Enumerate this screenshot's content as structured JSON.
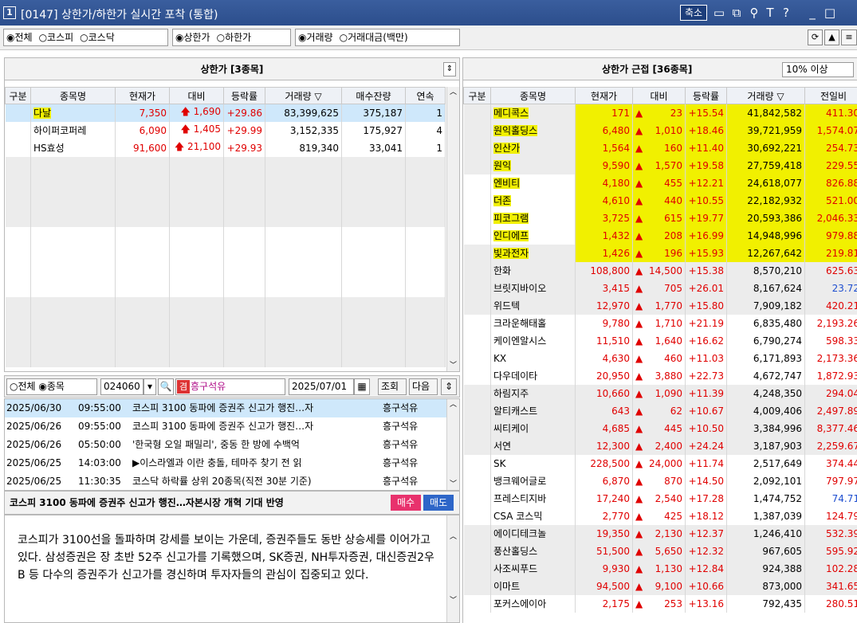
{
  "window": {
    "num": "1",
    "title": "[0147] 상한가/하한가 실시간 포착 (통합)",
    "shrink": "축소"
  },
  "toolbar": {
    "market": [
      "◉전체",
      "○코스피",
      "○코스닥"
    ],
    "limit": [
      "◉상한가",
      "○하한가"
    ],
    "basis": [
      "◉거래량",
      "○거래대금(백만)"
    ]
  },
  "left": {
    "title": "상한가 [3종목]",
    "headers": [
      "구분",
      "종목명",
      "현재가",
      "대비",
      "등락률",
      "거래량 ▽",
      "매수잔량",
      "연속"
    ],
    "rows": [
      {
        "name": "다날",
        "price": "7,350",
        "change": "1,690",
        "rate": "+29.86",
        "volume": "83,399,625",
        "bid": "375,187",
        "cont": "1"
      },
      {
        "name": "하이퍼코퍼레",
        "price": "6,090",
        "change": "1,405",
        "rate": "+29.99",
        "volume": "3,152,335",
        "bid": "175,927",
        "cont": "4"
      },
      {
        "name": "HS효성",
        "price": "91,600",
        "change": "21,100",
        "rate": "+29.93",
        "volume": "819,340",
        "bid": "33,041",
        "cont": "1"
      }
    ]
  },
  "right": {
    "title": "상한가 근접 [36종목]",
    "filter": "10% 이상",
    "headers": [
      "구분",
      "종목명",
      "현재가",
      "대비",
      "등락률",
      "거래량 ▽",
      "전일비"
    ],
    "rows": [
      {
        "name": "메디콕스",
        "price": "171",
        "change": "23",
        "rate": "+15.54",
        "volume": "41,842,582",
        "prev": "411.30",
        "hl": true
      },
      {
        "name": "원익홀딩스",
        "price": "6,480",
        "change": "1,010",
        "rate": "+18.46",
        "volume": "39,721,959",
        "prev": "1,574.07",
        "hl": true
      },
      {
        "name": "인산가",
        "price": "1,564",
        "change": "160",
        "rate": "+11.40",
        "volume": "30,692,221",
        "prev": "254.73",
        "hl": true
      },
      {
        "name": "원익",
        "price": "9,590",
        "change": "1,570",
        "rate": "+19.58",
        "volume": "27,759,418",
        "prev": "229.55",
        "hl": true
      },
      {
        "name": "엔비티",
        "price": "4,180",
        "change": "455",
        "rate": "+12.21",
        "volume": "24,618,077",
        "prev": "826.88",
        "hl": true
      },
      {
        "name": "더존",
        "price": "4,610",
        "change": "440",
        "rate": "+10.55",
        "volume": "22,182,932",
        "prev": "521.00",
        "hl": true
      },
      {
        "name": "피코그램",
        "price": "3,725",
        "change": "615",
        "rate": "+19.77",
        "volume": "20,593,386",
        "prev": "2,046.33",
        "hl": true
      },
      {
        "name": "인디에프",
        "price": "1,432",
        "change": "208",
        "rate": "+16.99",
        "volume": "14,948,996",
        "prev": "979.88",
        "hl": true
      },
      {
        "name": "빛과전자",
        "price": "1,426",
        "change": "196",
        "rate": "+15.93",
        "volume": "12,267,642",
        "prev": "219.81",
        "hl": true
      },
      {
        "name": "한화",
        "price": "108,800",
        "change": "14,500",
        "rate": "+15.38",
        "volume": "8,570,210",
        "prev": "625.63",
        "hl": false
      },
      {
        "name": "브릿지바이오",
        "price": "3,415",
        "change": "705",
        "rate": "+26.01",
        "volume": "8,167,624",
        "prev": "23.72",
        "hl": false,
        "prevBlue": true
      },
      {
        "name": "위드텍",
        "price": "12,970",
        "change": "1,770",
        "rate": "+15.80",
        "volume": "7,909,182",
        "prev": "420.21",
        "hl": false
      },
      {
        "name": "크라운해태홀",
        "price": "9,780",
        "change": "1,710",
        "rate": "+21.19",
        "volume": "6,835,480",
        "prev": "2,193.26",
        "hl": false
      },
      {
        "name": "케이엔알시스",
        "price": "11,510",
        "change": "1,640",
        "rate": "+16.62",
        "volume": "6,790,274",
        "prev": "598.33",
        "hl": false
      },
      {
        "name": "KX",
        "price": "4,630",
        "change": "460",
        "rate": "+11.03",
        "volume": "6,171,893",
        "prev": "2,173.36",
        "hl": false
      },
      {
        "name": "다우데이타",
        "price": "20,950",
        "change": "3,880",
        "rate": "+22.73",
        "volume": "4,672,747",
        "prev": "1,872.93",
        "hl": false
      },
      {
        "name": "하림지주",
        "price": "10,660",
        "change": "1,090",
        "rate": "+11.39",
        "volume": "4,248,350",
        "prev": "294.04",
        "hl": false
      },
      {
        "name": "알티캐스트",
        "price": "643",
        "change": "62",
        "rate": "+10.67",
        "volume": "4,009,406",
        "prev": "2,497.89",
        "hl": false
      },
      {
        "name": "씨티케이",
        "price": "4,685",
        "change": "445",
        "rate": "+10.50",
        "volume": "3,384,996",
        "prev": "8,377.46",
        "hl": false
      },
      {
        "name": "서연",
        "price": "12,300",
        "change": "2,400",
        "rate": "+24.24",
        "volume": "3,187,903",
        "prev": "2,259.67",
        "hl": false
      },
      {
        "name": "SK",
        "price": "228,500",
        "change": "24,000",
        "rate": "+11.74",
        "volume": "2,517,649",
        "prev": "374.44",
        "hl": false
      },
      {
        "name": "뱅크웨어글로",
        "price": "6,870",
        "change": "870",
        "rate": "+14.50",
        "volume": "2,092,101",
        "prev": "797.97",
        "hl": false
      },
      {
        "name": "프레스티지바",
        "price": "17,240",
        "change": "2,540",
        "rate": "+17.28",
        "volume": "1,474,752",
        "prev": "74.71",
        "hl": false,
        "prevBlue": true
      },
      {
        "name": "CSA 코스믹",
        "price": "2,770",
        "change": "425",
        "rate": "+18.12",
        "volume": "1,387,039",
        "prev": "124.79",
        "hl": false
      },
      {
        "name": "에이디테크놀",
        "price": "19,350",
        "change": "2,130",
        "rate": "+12.37",
        "volume": "1,246,410",
        "prev": "532.39",
        "hl": false
      },
      {
        "name": "풍산홀딩스",
        "price": "51,500",
        "change": "5,650",
        "rate": "+12.32",
        "volume": "967,605",
        "prev": "595.92",
        "hl": false
      },
      {
        "name": "사조씨푸드",
        "price": "9,930",
        "change": "1,130",
        "rate": "+12.84",
        "volume": "924,388",
        "prev": "102.28",
        "hl": false
      },
      {
        "name": "이마트",
        "price": "94,500",
        "change": "9,100",
        "rate": "+10.66",
        "volume": "873,000",
        "prev": "341.65",
        "hl": false
      },
      {
        "name": "포커스에이아",
        "price": "2,175",
        "change": "253",
        "rate": "+13.16",
        "volume": "792,435",
        "prev": "280.51",
        "hl": false
      }
    ]
  },
  "search": {
    "radio": "○전체 ◉종목",
    "code": "024060",
    "badge": "겸",
    "stock": "흥구석유",
    "date": "2025/07/01",
    "query_btn": "조회",
    "next_btn": "다음"
  },
  "news": [
    {
      "date": "2025/06/30",
      "time": "09:55:00",
      "title": "코스피 3100 동파에 증권주 신고가 행진…자",
      "stock": "흥구석유"
    },
    {
      "date": "2025/06/26",
      "time": "09:55:00",
      "title": "코스피 3100 동파에 증권주 신고가 행진…자",
      "stock": "흥구석유"
    },
    {
      "date": "2025/06/26",
      "time": "05:50:00",
      "title": "'한국형 오일 패밀리', 중동 한 방에 수백억",
      "stock": "흥구석유"
    },
    {
      "date": "2025/06/25",
      "time": "14:03:00",
      "title": "▶이스라엘과 이란 충돌, 테마주 찾기 전 읽",
      "stock": "흥구석유"
    },
    {
      "date": "2025/06/25",
      "time": "11:30:35",
      "title": "코스닥 하락률 상위 20종목(직전 30분 기준)",
      "stock": "흥구석유"
    }
  ],
  "article": {
    "title": "코스피 3100 동파에 증권주 신고가 행진…자본시장 개혁 기대 반영",
    "buy": "매수",
    "sell": "매도",
    "body": "코스피가 3100선을 돌파하며 강세를 보이는 가운데, 증권주들도 동반 상승세를 이어가고 있다. 삼성증권은 장 초반 52주 신고가를 기록했으며, SK증권, NH투자증권, 대신증권2우B 등 다수의 증권주가 신고가를 경신하며 투자자들의 관심이 집중되고 있다."
  },
  "colors": {
    "up": "#e00000",
    "highlight": "#f1f000",
    "selected": "#cfe8fb",
    "title": "#2c4e8c"
  }
}
